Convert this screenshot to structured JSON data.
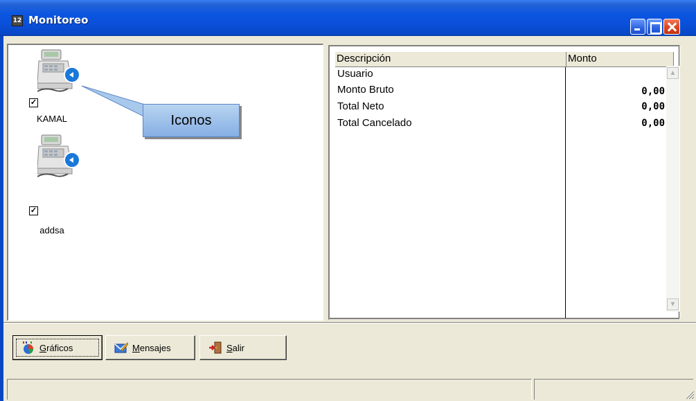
{
  "window": {
    "title": "Monitoreo",
    "app_icon": "app-icon"
  },
  "stations": [
    {
      "name": "KAMAL",
      "checked": true,
      "icon": "cash-register-icon"
    },
    {
      "name": "addsa",
      "checked": true,
      "icon": "cash-register-icon"
    }
  ],
  "callout": {
    "text": "Iconos"
  },
  "grid": {
    "columns": [
      "Descripción",
      "Monto"
    ],
    "rows": [
      {
        "descripcion": "Usuario",
        "monto": ""
      },
      {
        "descripcion": "Monto Bruto",
        "monto": "0,00"
      },
      {
        "descripcion": "Total Neto",
        "monto": "0,00"
      },
      {
        "descripcion": "Total Cancelado",
        "monto": "0,00"
      }
    ]
  },
  "buttons": {
    "graficos": {
      "label_prefix": "",
      "label_hotkey": "G",
      "label_rest": "ráficos",
      "icon": "chart-icon"
    },
    "mensajes": {
      "label_prefix": "",
      "label_hotkey": "M",
      "label_rest": "ensajes",
      "icon": "message-icon"
    },
    "salir": {
      "label_prefix": "",
      "label_hotkey": "S",
      "label_rest": "alir",
      "icon": "exit-door-icon"
    }
  },
  "status": {
    "panel1": "",
    "panel2": ""
  }
}
